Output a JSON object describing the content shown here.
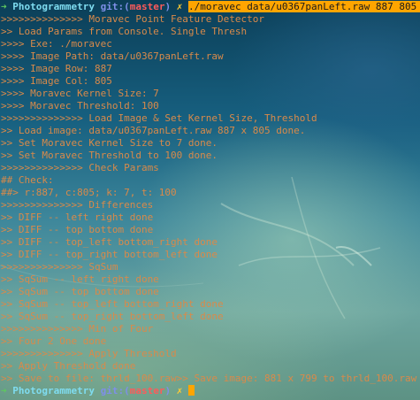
{
  "prompt": {
    "arrow": "➜",
    "dir": "Photogrammetry",
    "git": "git:",
    "branch_open": "(",
    "branch": "master",
    "branch_close": ")",
    "dirty": "✗",
    "command": "./moravec data/u0367panLeft.raw 887 805 7 100"
  },
  "output_lines": [
    ">>>>>>>>>>>>>> Moravec Point Feature Detector",
    ">> Load Params from Console. Single Thresh",
    ">>>> Exe: ./moravec",
    ">>>> Image Path: data/u0367panLeft.raw",
    ">>>> Image Row: 887",
    ">>>> Image Col: 805",
    ">>>> Moravec Kernel Size: 7",
    ">>>> Moravec Threshold: 100",
    ">>>>>>>>>>>>>> Load Image & Set Kernel Size, Threshold",
    ">> Load image: data/u0367panLeft.raw 887 x 805 done.",
    ">> Set Moravec Kernel Size to 7 done.",
    ">> Set Moravec Threshold to 100 done.",
    ">>>>>>>>>>>>>> Check Params",
    "## Check:",
    "##> r:887, c:805; k: 7, t: 100",
    ">>>>>>>>>>>>>> Differences",
    ">> DIFF -- left right done",
    ">> DIFF -- top bottom done",
    ">> DIFF -- top_left bottom_right done",
    ">> DIFF -- top_right bottom_left done",
    ">>>>>>>>>>>>>> SqSum",
    ">> SqSum -- left right done",
    ">> SqSum -- top bottom done",
    ">> SqSum -- top_left bottom_right done",
    ">> SqSum -- top_right bottom_left done",
    ">>>>>>>>>>>>>> Min of Four",
    ">> Four 2 One done",
    ">>>>>>>>>>>>>> Apply Threshold",
    ">> Apply Threshold done",
    ">> Save to file: thrld_100.raw>> Save image: 881 x 799 to thrld_100.raw done."
  ],
  "colors": {
    "prompt_arrow": "#5ec85e",
    "directory": "#7fdcf0",
    "git_label": "#7e8fe8",
    "branch": "#ff5a5a",
    "dirty_marker": "#ffcc33",
    "command_highlight": "#ffa500",
    "output_text": "#d98a4a"
  }
}
